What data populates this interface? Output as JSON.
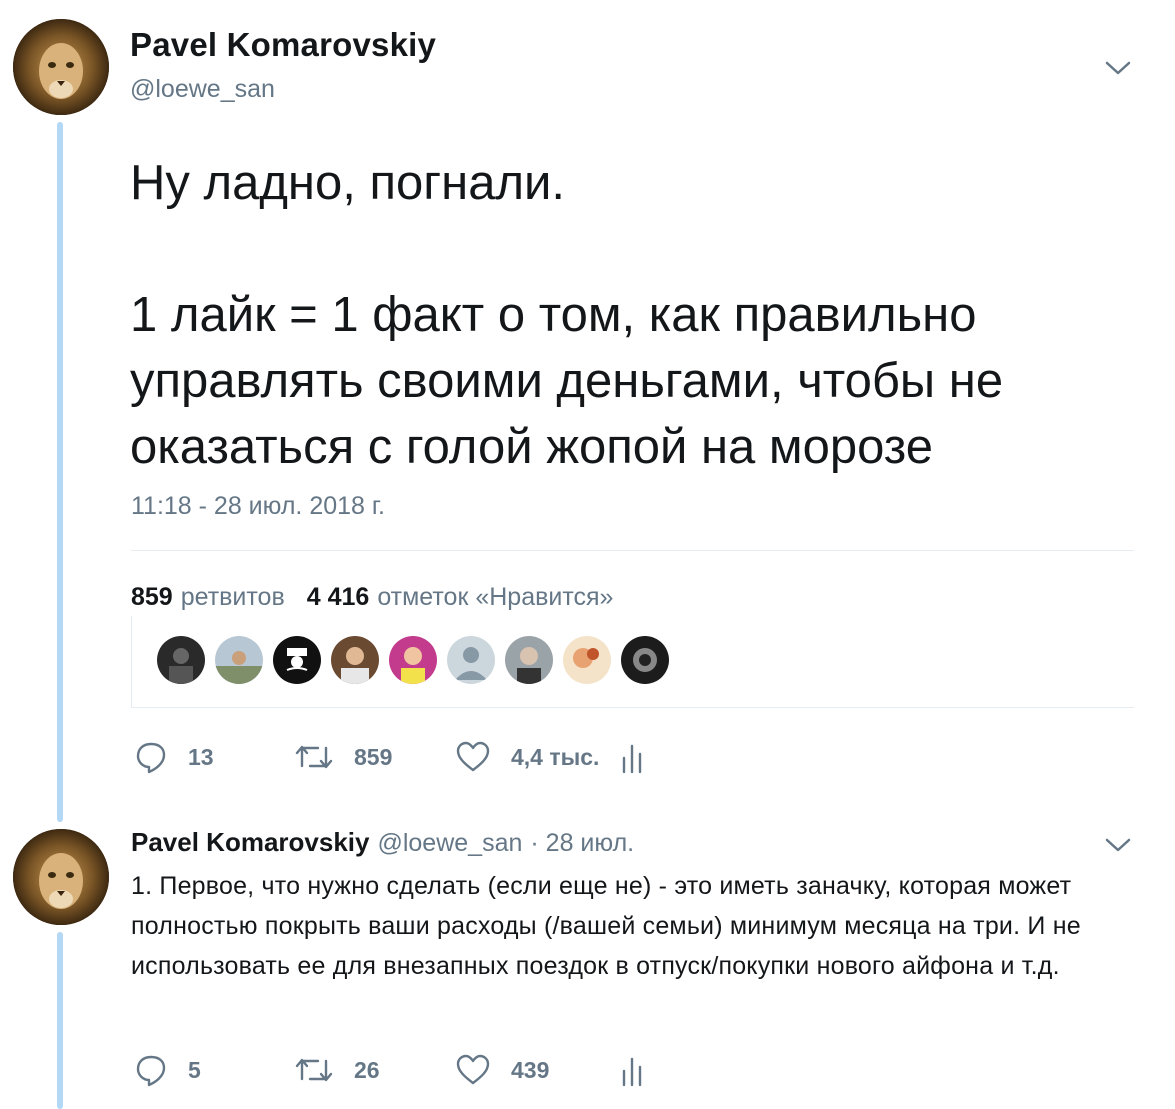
{
  "main_tweet": {
    "author_name": "Pavel Komarovskiy",
    "handle": "@loewe_san",
    "text": "Ну ладно, погнали.\n\n1 лайк = 1 факт о том, как правильно управлять своими деньгами, чтобы не оказаться с голой жопой на морозе",
    "timestamp": "11:18 - 28 июл. 2018 г.",
    "retweets_count": "859",
    "retweets_label": "ретвитов",
    "likes_count": "4 416",
    "likes_label": "отметок «Нравится»",
    "actions": {
      "reply_count": "13",
      "retweet_count": "859",
      "like_count": "4,4 тыс."
    }
  },
  "reply_tweet": {
    "author_name": "Pavel Komarovskiy",
    "handle": "@loewe_san",
    "date": "· 28 июл.",
    "text": "1. Первое, что нужно сделать (если еще не) - это иметь заначку, которая может полностью покрыть ваши расходы (/вашей семьи) минимум месяца на три. И не использовать ее для внезапных поездок в отпуск/покупки нового айфона и т.д.",
    "actions": {
      "reply_count": "5",
      "retweet_count": "26",
      "like_count": "439"
    }
  },
  "colors": {
    "accent_thread": "#b3d8f5",
    "muted_text": "#657786",
    "primary_text": "#14171a",
    "divider": "#e6ecf0"
  },
  "icons": [
    "chevron-down-icon",
    "reply-icon",
    "retweet-icon",
    "heart-icon",
    "analytics-icon"
  ]
}
